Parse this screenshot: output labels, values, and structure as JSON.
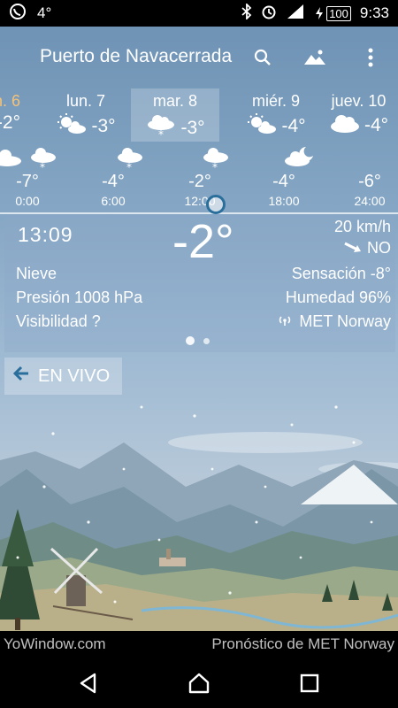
{
  "status": {
    "temp": "4°",
    "battery": "100",
    "time": "9:33"
  },
  "header": {
    "location": "Puerto de Navacerrada"
  },
  "days": [
    {
      "label": "n. 6",
      "temp": "-2°",
      "icon": "snow-cloud-icon",
      "label_color": "#f3c27a"
    },
    {
      "label": "lun. 7",
      "temp": "-3°",
      "icon": "sun-cloud-icon"
    },
    {
      "label": "mar. 8",
      "temp": "-3°",
      "icon": "snow-cloud-icon",
      "selected": true
    },
    {
      "label": "miér. 9",
      "temp": "-4°",
      "icon": "sun-cloud-icon"
    },
    {
      "label": "juev. 10",
      "temp": "-4°",
      "icon": "cloud-icon"
    }
  ],
  "hours": [
    {
      "time": "0:00",
      "temp": "-7°",
      "icon": "snow-cloud-icon"
    },
    {
      "time": "6:00",
      "temp": "-4°",
      "icon": "snow-cloud-icon"
    },
    {
      "time": "12:00",
      "temp": "-2°",
      "icon": "snow-cloud-icon"
    },
    {
      "time": "18:00",
      "temp": "-4°",
      "icon": "moon-cloud-icon"
    },
    {
      "time": "24:00",
      "temp": "-6°",
      "icon": "moon-cloud-icon"
    }
  ],
  "current": {
    "time": "13:09",
    "temp": "-2°",
    "wind_speed": "20 km/h",
    "wind_dir": "NO",
    "condition": "Nieve",
    "pressure": "Presión 1008 hPa",
    "visibility": "Visibilidad ?",
    "feels_like": "Sensación -8°",
    "humidity": "Humedad 96%",
    "source": "MET Norway"
  },
  "live_button": "EN VIVO",
  "footer": {
    "left": "YoWindow.com",
    "right": "Pronóstico de MET Norway"
  },
  "colors": {
    "accent": "#2a6f9c"
  }
}
